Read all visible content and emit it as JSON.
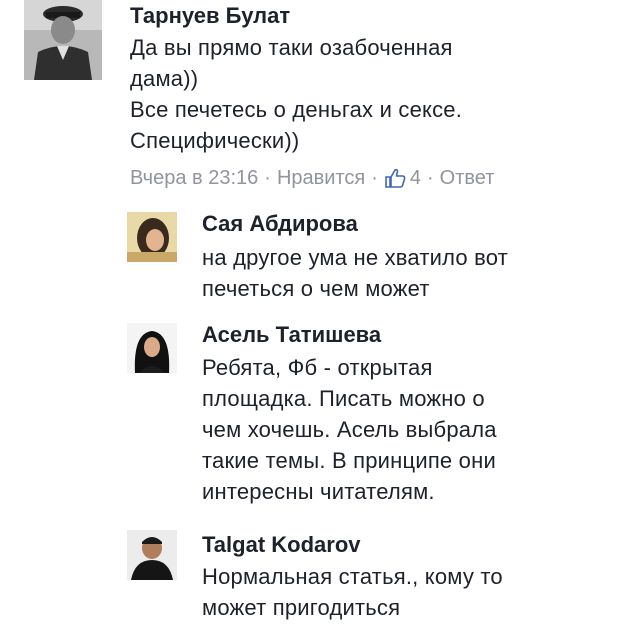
{
  "comments": [
    {
      "author": "Тарнуев Булат",
      "lines": [
        "Да вы прямо таки озабоченная",
        "дама))",
        "Все печетесь о деньгах и сексе.",
        "Специфически))"
      ],
      "meta": {
        "time": "Вчера в 23:16",
        "like_label": "Нравится",
        "like_count": "4",
        "reply_label": "Ответ"
      }
    },
    {
      "author": "Сая Абдирова",
      "lines": [
        "на другое ума не хватило вот",
        "печеться о чем может"
      ]
    },
    {
      "author": "Асель Татишева",
      "lines": [
        "Ребята, Фб - открытая",
        "площадка. Писать можно о",
        "чем хочешь. Асель выбрала",
        "такие темы. В принципе они",
        "интересны читателям."
      ]
    },
    {
      "author": "Talgat Kodarov",
      "lines": [
        "Нормальная статья., кому то",
        "может пригодиться"
      ]
    }
  ],
  "colors": {
    "text": "#1d2129",
    "meta": "#90949c",
    "like_icon": "#4267b2"
  }
}
